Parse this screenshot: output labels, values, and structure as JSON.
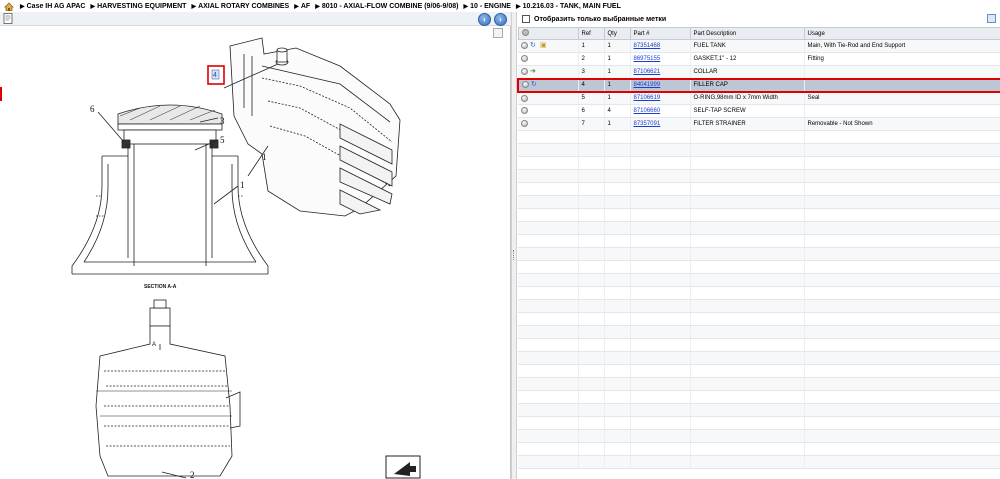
{
  "breadcrumb": {
    "items": [
      "Case IH AG APAC",
      "HARVESTING EQUIPMENT",
      "AXIAL ROTARY COMBINES",
      "AF",
      "8010 - AXIAL-FLOW COMBINE (9/06-9/08)",
      "10 - ENGINE",
      "10.216.03 - TANK, MAIN FUEL"
    ],
    "separator": "▶",
    "home_icon": "home-icon"
  },
  "left_toolbar": {
    "back_icon": "arrow-left-icon",
    "forward_icon": "arrow-right-icon",
    "back_glyph": "‹",
    "forward_glyph": "›"
  },
  "drawing": {
    "callouts": [
      "1",
      "2",
      "3",
      "5",
      "6",
      "1"
    ],
    "section_label": "SECTION  A-A",
    "section_mark": "A",
    "highlight_ref": "4"
  },
  "filter": {
    "label": "Отобразить только выбранные метки",
    "checked": false
  },
  "table": {
    "columns": [
      "",
      "Ref",
      "Qty",
      "Part #",
      "Part Description",
      "Usage"
    ],
    "rows": [
      {
        "ref": "1",
        "qty": "1",
        "part": "87351468",
        "desc": "FUEL TANK",
        "usage": "Main, With Tie-Rod and End Support",
        "actions": [
          "info-icon",
          "package-icon"
        ]
      },
      {
        "ref": "2",
        "qty": "1",
        "part": "86975155",
        "desc": "GASKET,1\" - 12",
        "usage": "Fitting",
        "actions": []
      },
      {
        "ref": "3",
        "qty": "1",
        "part": "87106621",
        "desc": "COLLAR",
        "usage": "",
        "actions": [
          "replace-arrow-icon"
        ]
      },
      {
        "ref": "4",
        "qty": "1",
        "part": "84041999",
        "desc": "FILLER CAP",
        "usage": "",
        "actions": [
          "info-icon"
        ]
      },
      {
        "ref": "5",
        "qty": "1",
        "part": "87106619",
        "desc": "O-RING,98mm ID x 7mm Width",
        "usage": "Seal",
        "actions": []
      },
      {
        "ref": "6",
        "qty": "4",
        "part": "87106660",
        "desc": "SELF-TAP SCREW",
        "usage": "",
        "actions": []
      },
      {
        "ref": "7",
        "qty": "1",
        "part": "87357091",
        "desc": "FILTER STRAINER",
        "usage": "Removable - Not Shown",
        "actions": []
      }
    ],
    "selected_index": 3
  },
  "colors": {
    "link": "#1a3fd0",
    "selection_border": "#dd0000",
    "selection_fill": "#bcc6d4",
    "header_fill": "#e9ecf1"
  }
}
